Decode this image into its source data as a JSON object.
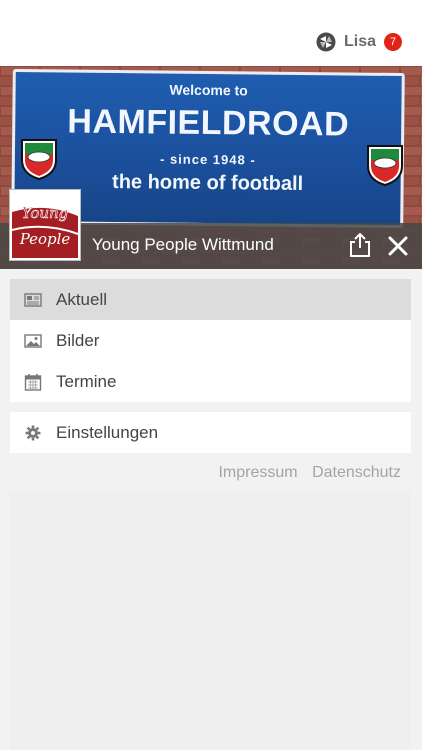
{
  "user": {
    "name": "Lisa",
    "badge_count": "7"
  },
  "banner": {
    "sign_line1": "Welcome to",
    "sign_line2": "HAMFIELDROAD",
    "sign_line3": "- since 1948 -",
    "sign_line4": "the home of football",
    "logo_text_1": "Young",
    "logo_text_2": "People",
    "club_name": "Young People Wittmund"
  },
  "menu": {
    "items": [
      {
        "label": "Aktuell",
        "icon": "newspaper-icon",
        "active": true
      },
      {
        "label": "Bilder",
        "icon": "image-icon",
        "active": false
      },
      {
        "label": "Termine",
        "icon": "calendar-icon",
        "active": false
      }
    ],
    "settings": {
      "label": "Einstellungen",
      "icon": "gear-icon"
    }
  },
  "footer_links": {
    "impressum": "Impressum",
    "datenschutz": "Datenschutz"
  },
  "colors": {
    "badge": "#e2231a",
    "sign_blue": "#1f5db0",
    "overlay": "#464646"
  }
}
